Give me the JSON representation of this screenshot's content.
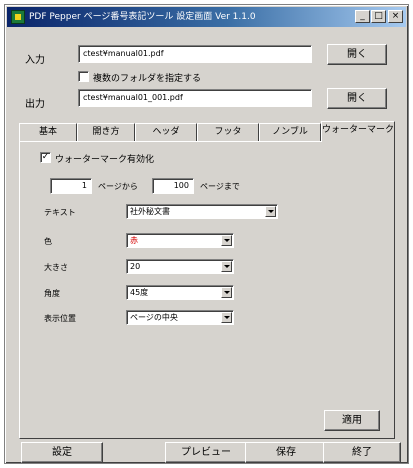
{
  "window": {
    "title": "PDF Pepper  ページ番号表記ツール 設定画面  Ver 1.1.0"
  },
  "titlebar_buttons": {
    "minimize": "_",
    "maximize": "□",
    "close": "×"
  },
  "input": {
    "label": "入力",
    "value": "ctest¥manual01.pdf",
    "open_label": "開く"
  },
  "folder_option": {
    "label": "複数のフォルダを指定する",
    "checked": ""
  },
  "output": {
    "label": "出力",
    "value": "ctest¥manual01_001.pdf",
    "open_label": "開く"
  },
  "tabs": [
    "基本",
    "開き方",
    "ヘッダ",
    "フッタ",
    "ノンブル",
    "ウォーターマーク"
  ],
  "watermark": {
    "enable_label": "ウォーターマーク有効化",
    "enable_checked": "✓",
    "from_value": "1",
    "from_suffix": "ページから",
    "to_value": "100",
    "to_suffix": "ページまで",
    "text_label": "テキスト",
    "text_value": "社外秘文書",
    "color_label": "色",
    "color_value": "赤",
    "size_label": "大きさ",
    "size_value": "20",
    "angle_label": "角度",
    "angle_value": "45度",
    "position_label": "表示位置",
    "position_value": "ページの中央",
    "apply_label": "適用"
  },
  "footer": {
    "settings": "設定",
    "preview": "プレビュー",
    "save": "保存",
    "exit": "終了"
  }
}
